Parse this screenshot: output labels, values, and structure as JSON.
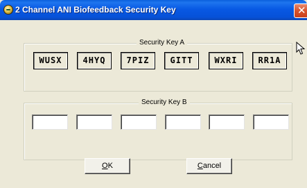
{
  "window": {
    "title": "2 Channel ANI Biofeedback Security Key",
    "close_glyph": "✕"
  },
  "group_a": {
    "label": "Security Key A",
    "keys": [
      "WUSX",
      "4HYQ",
      "7PIZ",
      "GITT",
      "WXRI",
      "RR1A"
    ]
  },
  "group_b": {
    "label": "Security Key B",
    "inputs": [
      "",
      "",
      "",
      "",
      "",
      ""
    ]
  },
  "buttons": {
    "ok_accel": "O",
    "ok_rest": "K",
    "cancel_accel": "C",
    "cancel_rest": "ancel"
  },
  "colors": {
    "titlebar": "#0651D8",
    "dialog_bg": "#ECE9D8",
    "close_button": "#D8532B"
  },
  "icons": {
    "app": "biofeedback-app-icon",
    "close": "close-icon",
    "cursor": "mouse-pointer-icon"
  }
}
